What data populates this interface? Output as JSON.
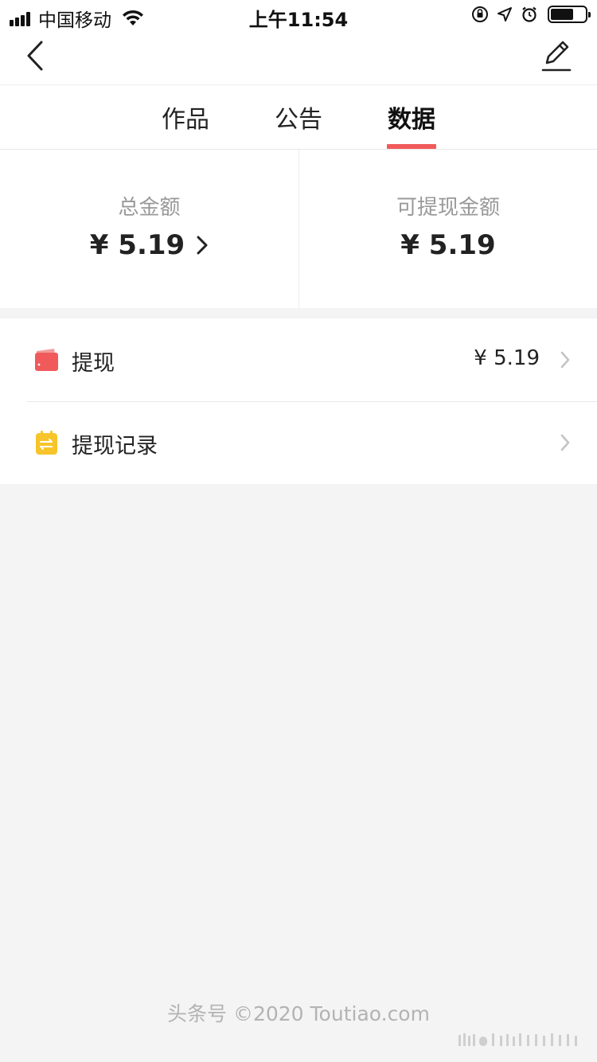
{
  "status_bar": {
    "carrier": "中国移动",
    "time": "上午11:54"
  },
  "nav": {
    "back_icon": "chevron-left-icon",
    "edit_icon": "pencil-edit-icon"
  },
  "tabs": [
    {
      "label": "作品",
      "active": false
    },
    {
      "label": "公告",
      "active": false
    },
    {
      "label": "数据",
      "active": true
    }
  ],
  "summary": {
    "total_label": "总金额",
    "total_value": "¥ 5.19",
    "withdrawable_label": "可提现金额",
    "withdrawable_value": "¥ 5.19"
  },
  "list": [
    {
      "label": "提现",
      "value": "¥ 5.19",
      "icon": "wallet-icon",
      "icon_color": "#f05a5a"
    },
    {
      "label": "提现记录",
      "value": "",
      "icon": "transfer-record-icon",
      "icon_color": "#f7c52b"
    }
  ],
  "footer": {
    "text": "头条号 ©2020 Toutiao.com"
  },
  "colors": {
    "accent": "#f15a5a",
    "background": "#f4f4f4"
  }
}
